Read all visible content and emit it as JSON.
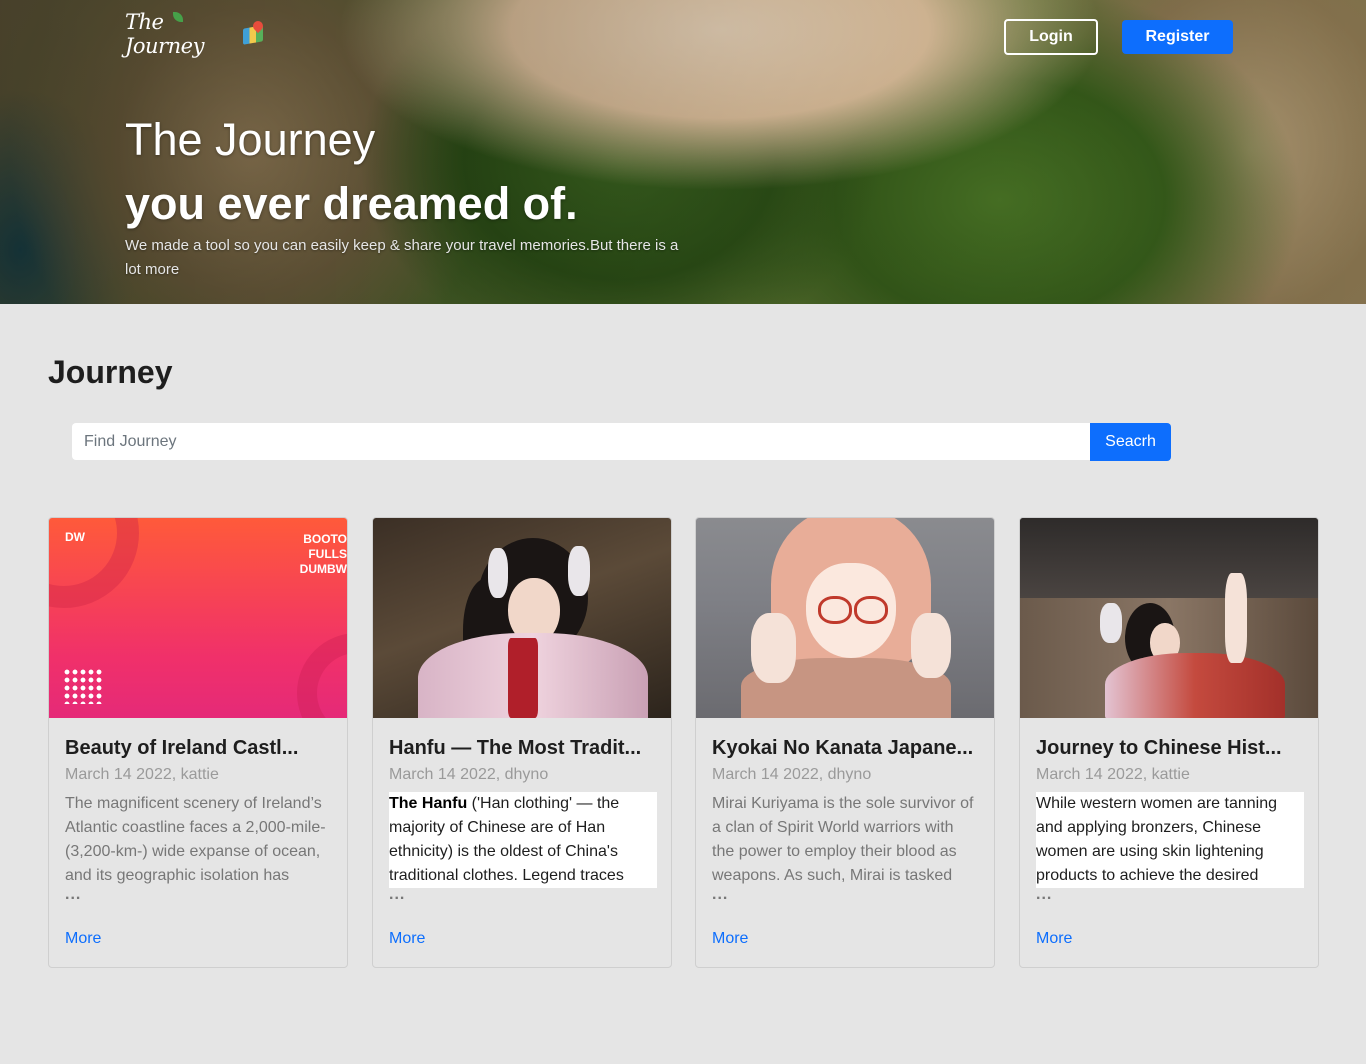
{
  "brand": {
    "logo_text": "The Journey"
  },
  "nav": {
    "login_label": "Login",
    "register_label": "Register"
  },
  "hero": {
    "title_line1": "The Journey",
    "title_line2": "you ever dreamed of.",
    "subtitle": "We made a tool so you can easily keep & share your travel memories.But there is a lot more"
  },
  "section": {
    "title": "Journey"
  },
  "search": {
    "placeholder": "Find Journey",
    "button_label": "Seacrh"
  },
  "cards": [
    {
      "title": "Beauty of Ireland Castl...",
      "meta": "March 14 2022, kattie",
      "description": "The magnificent scenery of Ireland’s Atlantic coastline faces a 2,000-mile-(3,200-km-) wide expanse of ocean, and its geographic isolation has",
      "ellipsis": "...",
      "more_label": "More",
      "image_text_brand": "DW",
      "image_text_line1": "BOOTO",
      "image_text_line2": "FULLS",
      "image_text_line3": "DUMBW"
    },
    {
      "title": "Hanfu — The Most Tradit...",
      "meta": "March 14 2022, dhyno",
      "description_bold": "The Hanfu",
      "description": " ('Han clothing' — the majority of Chinese are of Han ethnicity) is the oldest of China's traditional clothes. Legend traces",
      "ellipsis": "...",
      "more_label": "More"
    },
    {
      "title": "Kyokai No Kanata Japane...",
      "meta": "March 14 2022, dhyno",
      "description": "Mirai Kuriyama is the sole survivor of a clan of Spirit World warriors with the power to employ their blood as weapons. As such, Mirai is tasked",
      "ellipsis": "...",
      "more_label": "More"
    },
    {
      "title": "Journey to Chinese Hist...",
      "meta": "March 14 2022, kattie",
      "description": "While western women are tanning and applying bronzers, Chinese women are using skin lightening products to achieve the desired",
      "ellipsis": "...",
      "more_label": "More"
    }
  ],
  "colors": {
    "primary": "#0d6efd",
    "page_bg": "#e5e5e5"
  }
}
